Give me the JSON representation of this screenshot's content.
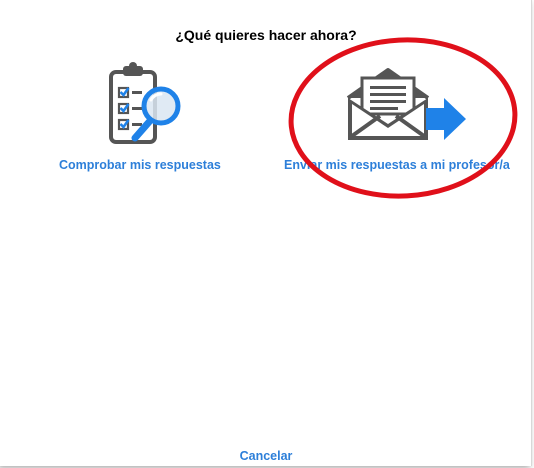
{
  "dialog": {
    "title": "¿Qué quieres hacer ahora?",
    "options": [
      {
        "label": "Comprobar mis respuestas",
        "icon": "clipboard-check-magnifier-icon"
      },
      {
        "label": "Enviar mis respuestas a mi profesor/a",
        "icon": "envelope-send-arrow-icon"
      }
    ],
    "cancel_label": "Cancelar"
  },
  "annotation": {
    "shape": "ellipse",
    "color": "#e0101a",
    "target": "send-answers-option"
  },
  "colors": {
    "link": "#2d7fd9",
    "icon_gray": "#555555",
    "icon_blue": "#1f82e8",
    "title": "#000000",
    "background": "#ffffff"
  }
}
